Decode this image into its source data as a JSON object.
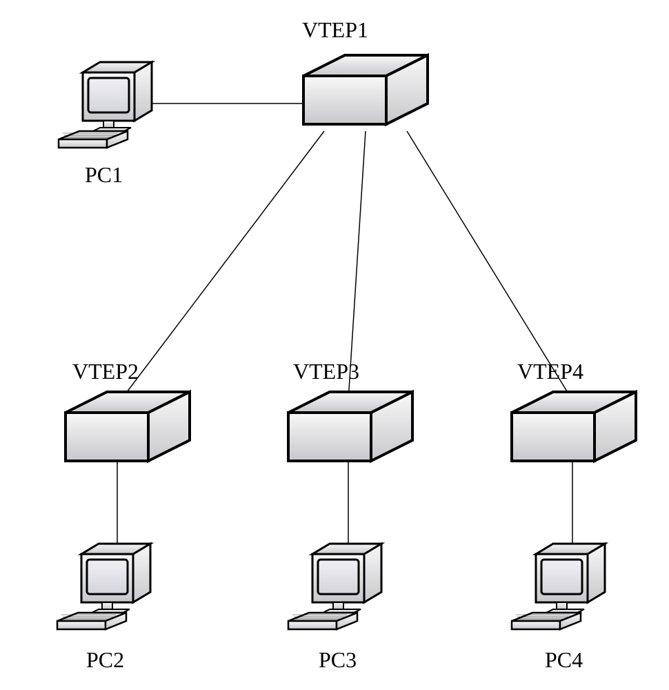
{
  "diagram": {
    "nodes": {
      "vtep1": {
        "label": "VTEP1",
        "type": "router"
      },
      "vtep2": {
        "label": "VTEP2",
        "type": "router"
      },
      "vtep3": {
        "label": "VTEP3",
        "type": "router"
      },
      "vtep4": {
        "label": "VTEP4",
        "type": "router"
      },
      "pc1": {
        "label": "PC1",
        "type": "computer"
      },
      "pc2": {
        "label": "PC2",
        "type": "computer"
      },
      "pc3": {
        "label": "PC3",
        "type": "computer"
      },
      "pc4": {
        "label": "PC4",
        "type": "computer"
      }
    },
    "edges": [
      [
        "pc1",
        "vtep1"
      ],
      [
        "vtep1",
        "vtep2"
      ],
      [
        "vtep1",
        "vtep3"
      ],
      [
        "vtep1",
        "vtep4"
      ],
      [
        "vtep2",
        "pc2"
      ],
      [
        "vtep3",
        "pc3"
      ],
      [
        "vtep4",
        "pc4"
      ]
    ]
  }
}
